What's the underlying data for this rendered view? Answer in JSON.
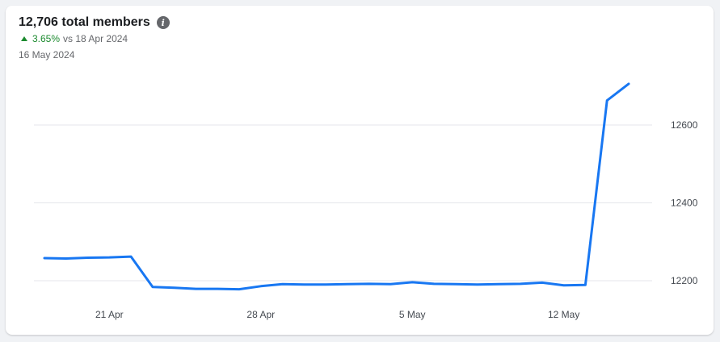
{
  "header": {
    "title": "12,706 total members",
    "change_pct": "3.65%",
    "change_compare": "vs 18 Apr 2024",
    "date": "16 May 2024"
  },
  "colors": {
    "line": "#1877f2",
    "grid": "#e4e6eb",
    "up": "#1b8a2e"
  },
  "chart_data": {
    "type": "line",
    "title": "12,706 total members",
    "xlabel": "",
    "ylabel": "",
    "grid": true,
    "y_ticks": [
      12200,
      12400,
      12600
    ],
    "ylim": [
      12180,
      12630
    ],
    "x_ticks": [
      {
        "label": "21 Apr",
        "date": "2024-04-21"
      },
      {
        "label": "28 Apr",
        "date": "2024-04-28"
      },
      {
        "label": "5 May",
        "date": "2024-05-05"
      },
      {
        "label": "12 May",
        "date": "2024-05-12"
      }
    ],
    "series": [
      {
        "points": [
          {
            "x": "2024-04-18",
            "y": 12258
          },
          {
            "x": "2024-04-19",
            "y": 12257
          },
          {
            "x": "2024-04-20",
            "y": 12259
          },
          {
            "x": "2024-04-21",
            "y": 12260
          },
          {
            "x": "2024-04-22",
            "y": 12262
          },
          {
            "x": "2024-04-23",
            "y": 12184
          },
          {
            "x": "2024-04-24",
            "y": 12182
          },
          {
            "x": "2024-04-25",
            "y": 12179
          },
          {
            "x": "2024-04-26",
            "y": 12179
          },
          {
            "x": "2024-04-27",
            "y": 12178
          },
          {
            "x": "2024-04-28",
            "y": 12186
          },
          {
            "x": "2024-04-29",
            "y": 12191
          },
          {
            "x": "2024-04-30",
            "y": 12190
          },
          {
            "x": "2024-05-01",
            "y": 12190
          },
          {
            "x": "2024-05-02",
            "y": 12191
          },
          {
            "x": "2024-05-03",
            "y": 12192
          },
          {
            "x": "2024-05-04",
            "y": 12191
          },
          {
            "x": "2024-05-05",
            "y": 12196
          },
          {
            "x": "2024-05-06",
            "y": 12192
          },
          {
            "x": "2024-05-07",
            "y": 12191
          },
          {
            "x": "2024-05-08",
            "y": 12190
          },
          {
            "x": "2024-05-09",
            "y": 12191
          },
          {
            "x": "2024-05-10",
            "y": 12192
          },
          {
            "x": "2024-05-11",
            "y": 12195
          },
          {
            "x": "2024-05-12",
            "y": 12188
          },
          {
            "x": "2024-05-13",
            "y": 12189
          },
          {
            "x": "2024-05-14",
            "y": 12663
          },
          {
            "x": "2024-05-15",
            "y": 12706
          }
        ]
      }
    ]
  }
}
